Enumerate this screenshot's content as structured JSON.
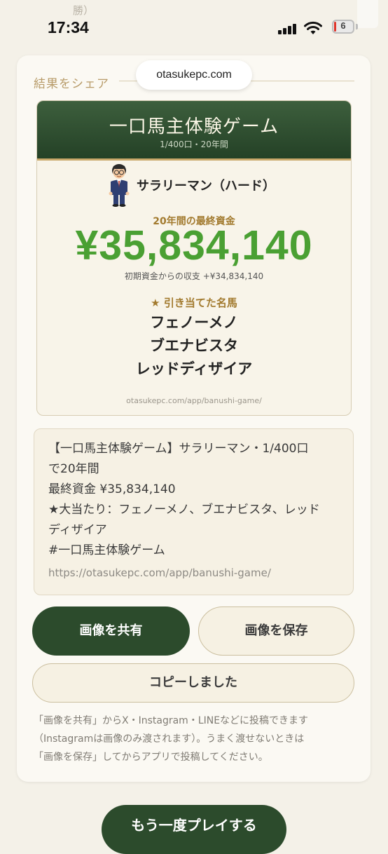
{
  "status_bar": {
    "peek_text": "勝）",
    "time": "17:34",
    "battery": "6"
  },
  "share_section": {
    "label": "結果をシェア",
    "url_pill": "otasukepc.com"
  },
  "result_card": {
    "title": "一口馬主体験ゲーム",
    "subtitle": "1/400口・20年間",
    "player": "サラリーマン（ハード）",
    "fund_label": "20年間の最終資金",
    "fund_amount": "¥35,834,140",
    "balance": "初期資金からの収支 +¥34,834,140",
    "horses_title": "★ 引き当てた名馬",
    "horses": [
      "フェノーメノ",
      "ブエナビスタ",
      "レッドディザイア"
    ],
    "url": "otasukepc.com/app/banushi-game/"
  },
  "share_text": {
    "lines": [
      "【一口馬主体験ゲーム】サラリーマン・1/400口",
      "で20年間",
      "最終資金 ¥35,834,140",
      "★大当たり：フェノーメノ、ブエナビスタ、レッド",
      "ディザイア",
      "#一口馬主体験ゲーム"
    ],
    "link": "https://otasukepc.com/app/banushi-game/"
  },
  "buttons": {
    "share_image": "画像を共有",
    "save_image": "画像を保存",
    "copy": "コピーしました",
    "replay": "もう一度プレイする"
  },
  "note": [
    "「画像を共有」からX・Instagram・LINEなどに投稿できます",
    "（Instagramは画像のみ渡されます）。うまく渡せないときは",
    "「画像を保存」してからアプリで投稿してください。"
  ],
  "colors": {
    "accent_green": "#2c4b2c",
    "amount_green": "#4aa033",
    "gold": "#a27a2e",
    "background": "#f4f1e8"
  }
}
